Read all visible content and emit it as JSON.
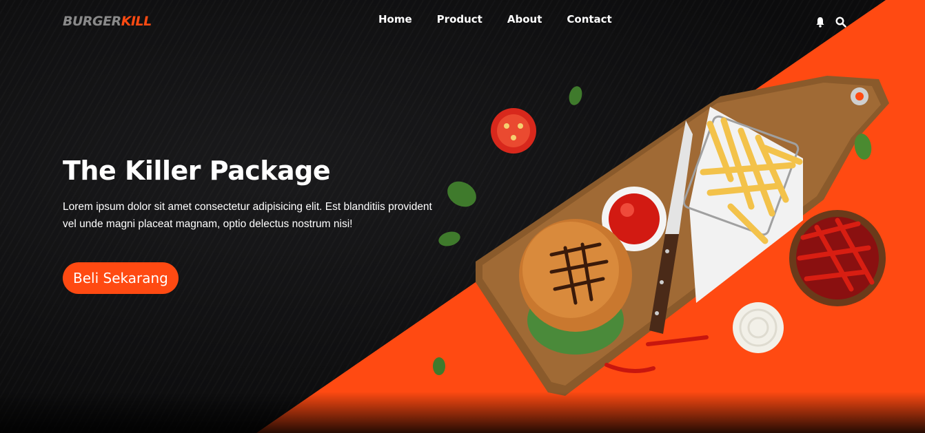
{
  "brand": {
    "part1": "BURGER",
    "part2": "KILL"
  },
  "nav": {
    "items": [
      {
        "label": "Home"
      },
      {
        "label": "Product"
      },
      {
        "label": "About"
      },
      {
        "label": "Contact"
      }
    ]
  },
  "header_icons": [
    "bell-icon",
    "search-icon"
  ],
  "hero": {
    "title": "The Killer Package",
    "description": "Lorem ipsum dolor sit amet consectetur adipisicing elit. Est blanditiis provident vel unde magni placeat magnam, optio delectus nostrum nisi!",
    "cta_label": "Beli Sekarang"
  },
  "colors": {
    "accent": "#ff4a12",
    "background": "#0f0f10",
    "logo_gray": "#8a8a8a"
  }
}
